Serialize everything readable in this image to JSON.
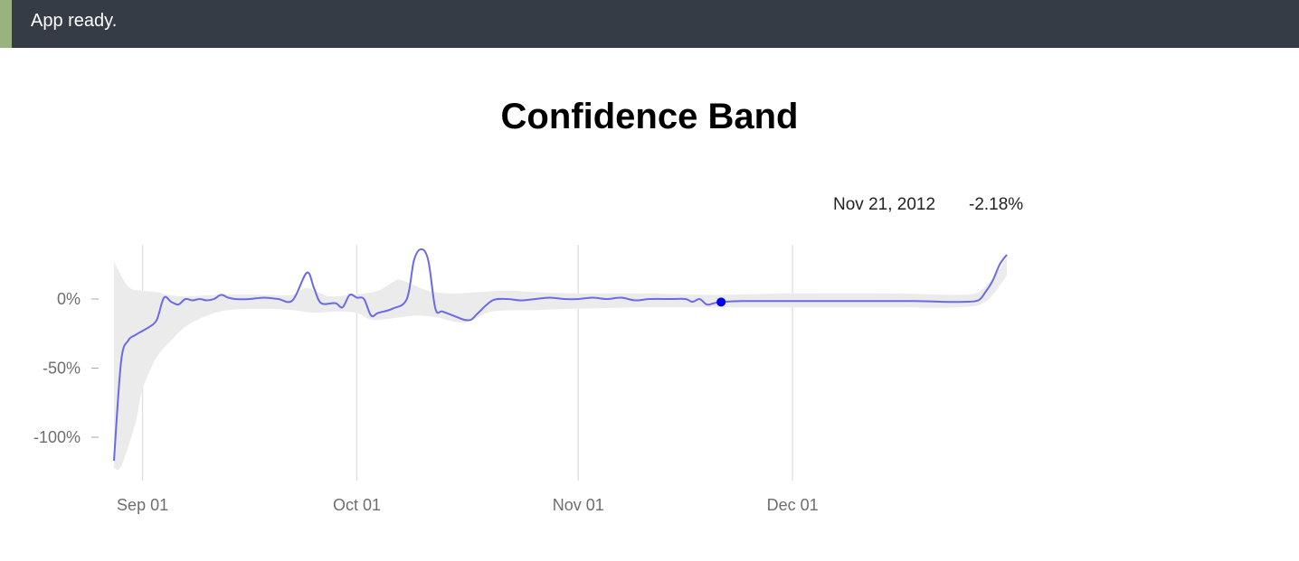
{
  "status": {
    "message": "App ready."
  },
  "page": {
    "title": "Confidence Band"
  },
  "tooltip": {
    "date": "Nov 21, 2012",
    "value": "-2.18%"
  },
  "colors": {
    "line": "#6a6ae6",
    "band": "#ebebeb",
    "marker": "#0000ee",
    "status_bar": "#353c46",
    "status_accent": "#98b37f"
  },
  "chart_data": {
    "type": "line",
    "title": "Confidence Band",
    "xlabel": "",
    "ylabel": "",
    "x_unit": "date",
    "ylim": [
      -120,
      40
    ],
    "xlim": [
      "2012-08-28",
      "2012-12-31"
    ],
    "x_ticks": [
      {
        "value": "2012-09-01",
        "label": "Sep 01"
      },
      {
        "value": "2012-10-01",
        "label": "Oct 01"
      },
      {
        "value": "2012-11-01",
        "label": "Nov 01"
      },
      {
        "value": "2012-12-01",
        "label": "Dec 01"
      }
    ],
    "y_ticks": [
      {
        "value": 0,
        "label": "0%"
      },
      {
        "value": -50,
        "label": "-50%"
      },
      {
        "value": -100,
        "label": "-100%"
      }
    ],
    "grid": {
      "vertical": true,
      "horizontal": false
    },
    "series": [
      {
        "values": [
          [
            "2012-08-28",
            -117
          ],
          [
            "2012-08-29",
            -45
          ],
          [
            "2012-08-30",
            -30
          ],
          [
            "2012-08-31",
            -26
          ],
          [
            "2012-09-01",
            -23
          ],
          [
            "2012-09-02",
            -20
          ],
          [
            "2012-09-03",
            -15
          ],
          [
            "2012-09-04",
            1
          ],
          [
            "2012-09-05",
            -2
          ],
          [
            "2012-09-06",
            -4
          ],
          [
            "2012-09-07",
            0
          ],
          [
            "2012-09-08",
            -1
          ],
          [
            "2012-09-09",
            0
          ],
          [
            "2012-09-10",
            -1
          ],
          [
            "2012-09-11",
            0
          ],
          [
            "2012-09-12",
            3
          ],
          [
            "2012-09-13",
            1
          ],
          [
            "2012-09-14",
            0
          ],
          [
            "2012-09-16",
            0
          ],
          [
            "2012-09-18",
            1
          ],
          [
            "2012-09-20",
            0
          ],
          [
            "2012-09-22",
            -1
          ],
          [
            "2012-09-24",
            19
          ],
          [
            "2012-09-25",
            8
          ],
          [
            "2012-09-26",
            -3
          ],
          [
            "2012-09-28",
            -3
          ],
          [
            "2012-09-29",
            -6
          ],
          [
            "2012-09-30",
            3
          ],
          [
            "2012-10-01",
            1
          ],
          [
            "2012-10-02",
            0
          ],
          [
            "2012-10-03",
            -12
          ],
          [
            "2012-10-04",
            -10
          ],
          [
            "2012-10-06",
            -7
          ],
          [
            "2012-10-08",
            0
          ],
          [
            "2012-10-09",
            28
          ],
          [
            "2012-10-10",
            36
          ],
          [
            "2012-10-11",
            28
          ],
          [
            "2012-10-12",
            -7
          ],
          [
            "2012-10-13",
            -9
          ],
          [
            "2012-10-15",
            -13
          ],
          [
            "2012-10-16",
            -15
          ],
          [
            "2012-10-17",
            -15
          ],
          [
            "2012-10-18",
            -10
          ],
          [
            "2012-10-20",
            -1
          ],
          [
            "2012-10-22",
            0
          ],
          [
            "2012-10-24",
            -1
          ],
          [
            "2012-10-26",
            0
          ],
          [
            "2012-10-28",
            1
          ],
          [
            "2012-10-30",
            0
          ],
          [
            "2012-11-01",
            0
          ],
          [
            "2012-11-03",
            1
          ],
          [
            "2012-11-05",
            0
          ],
          [
            "2012-11-07",
            1
          ],
          [
            "2012-11-09",
            -1
          ],
          [
            "2012-11-11",
            0
          ],
          [
            "2012-11-14",
            0
          ],
          [
            "2012-11-16",
            0
          ],
          [
            "2012-11-17",
            -2
          ],
          [
            "2012-11-18",
            0
          ],
          [
            "2012-11-19",
            -4
          ],
          [
            "2012-11-20",
            -3
          ],
          [
            "2012-11-21",
            -2.18
          ],
          [
            "2012-11-24",
            -1.5
          ],
          [
            "2012-12-01",
            -1.5
          ],
          [
            "2012-12-10",
            -1.5
          ],
          [
            "2012-12-18",
            -1.5
          ],
          [
            "2012-12-22",
            -2
          ],
          [
            "2012-12-25",
            -2
          ],
          [
            "2012-12-27",
            -1
          ],
          [
            "2012-12-28",
            5
          ],
          [
            "2012-12-29",
            13
          ],
          [
            "2012-12-30",
            25
          ],
          [
            "2012-12-31",
            32
          ]
        ]
      }
    ],
    "band": {
      "upper": [
        [
          "2012-08-28",
          27
        ],
        [
          "2012-08-30",
          9
        ],
        [
          "2012-09-01",
          6
        ],
        [
          "2012-09-03",
          5
        ],
        [
          "2012-09-06",
          2
        ],
        [
          "2012-09-12",
          3
        ],
        [
          "2012-09-18",
          3
        ],
        [
          "2012-09-22",
          3
        ],
        [
          "2012-09-24",
          8
        ],
        [
          "2012-09-27",
          2
        ],
        [
          "2012-09-30",
          3
        ],
        [
          "2012-10-02",
          4
        ],
        [
          "2012-10-04",
          6
        ],
        [
          "2012-10-06",
          12
        ],
        [
          "2012-10-07",
          14
        ],
        [
          "2012-10-09",
          10
        ],
        [
          "2012-10-11",
          6
        ],
        [
          "2012-10-14",
          4
        ],
        [
          "2012-10-18",
          5
        ],
        [
          "2012-10-22",
          6
        ],
        [
          "2012-10-26",
          5
        ],
        [
          "2012-11-01",
          4
        ],
        [
          "2012-11-10",
          4
        ],
        [
          "2012-11-20",
          3
        ],
        [
          "2012-12-01",
          4
        ],
        [
          "2012-12-15",
          4
        ],
        [
          "2012-12-24",
          3
        ],
        [
          "2012-12-27",
          5
        ],
        [
          "2012-12-29",
          15
        ],
        [
          "2012-12-31",
          30
        ]
      ],
      "lower": [
        [
          "2012-08-28",
          -122
        ],
        [
          "2012-08-29",
          -121
        ],
        [
          "2012-08-31",
          -90
        ],
        [
          "2012-09-01",
          -65
        ],
        [
          "2012-09-03",
          -42
        ],
        [
          "2012-09-05",
          -30
        ],
        [
          "2012-09-07",
          -20
        ],
        [
          "2012-09-10",
          -12
        ],
        [
          "2012-09-13",
          -8
        ],
        [
          "2012-09-18",
          -7
        ],
        [
          "2012-09-22",
          -8
        ],
        [
          "2012-09-25",
          -10
        ],
        [
          "2012-09-28",
          -9
        ],
        [
          "2012-10-01",
          -10
        ],
        [
          "2012-10-03",
          -15
        ],
        [
          "2012-10-06",
          -14
        ],
        [
          "2012-10-09",
          -12
        ],
        [
          "2012-10-12",
          -13
        ],
        [
          "2012-10-16",
          -17
        ],
        [
          "2012-10-20",
          -9
        ],
        [
          "2012-10-26",
          -8
        ],
        [
          "2012-11-01",
          -7
        ],
        [
          "2012-11-10",
          -6
        ],
        [
          "2012-11-20",
          -6
        ],
        [
          "2012-12-01",
          -6
        ],
        [
          "2012-12-15",
          -6
        ],
        [
          "2012-12-24",
          -6
        ],
        [
          "2012-12-28",
          -2
        ],
        [
          "2012-12-31",
          17
        ]
      ]
    },
    "highlight": {
      "x": "2012-11-21",
      "y": -2.18
    }
  }
}
